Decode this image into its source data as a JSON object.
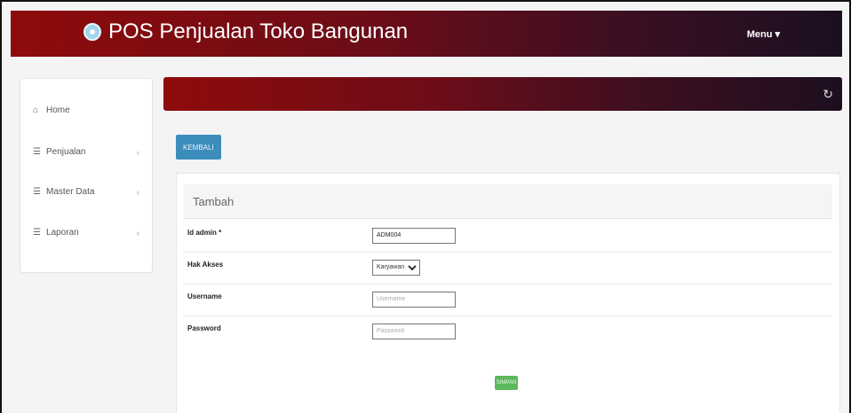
{
  "app": {
    "title": "POS Penjualan Toko Bangunan",
    "menu_label": "Menu ▾"
  },
  "sidebar": {
    "items": [
      {
        "label": "Home",
        "icon": "home-icon"
      },
      {
        "label": "Penjualan",
        "icon": "list-icon"
      },
      {
        "label": "Master Data",
        "icon": "list-icon"
      },
      {
        "label": "Laporan",
        "icon": "list-icon"
      }
    ]
  },
  "toolbar": {
    "back_label": "KEMBALI"
  },
  "form": {
    "title": "Tambah",
    "fields": [
      {
        "label": "Id admin *",
        "value": "ADM004"
      },
      {
        "label": "Hak Akses",
        "selected": "Karyawan"
      },
      {
        "label": "Username",
        "placeholder": "Username"
      },
      {
        "label": "Password",
        "placeholder": "Password"
      }
    ],
    "submit_label": "SIMPAN"
  }
}
